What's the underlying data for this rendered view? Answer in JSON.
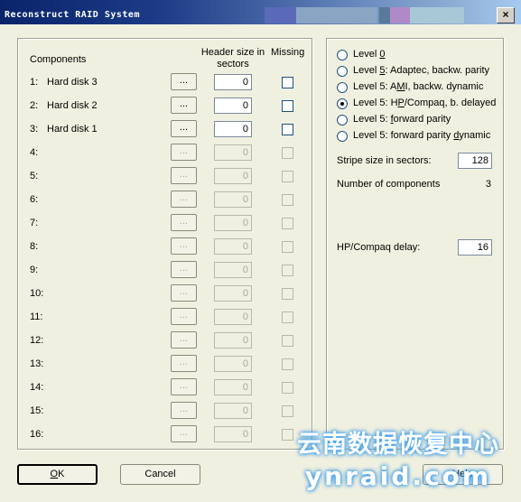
{
  "window": {
    "title": "Reconstruct RAID System",
    "close_label": "×"
  },
  "left": {
    "headers": {
      "components": "Components",
      "header_size": "Header size in sectors",
      "missing": "Missing"
    },
    "browse_label": "...",
    "rows": [
      {
        "num": "1:",
        "name": "Hard disk 3",
        "value": "0",
        "enabled": true
      },
      {
        "num": "2:",
        "name": "Hard disk 2",
        "value": "0",
        "enabled": true
      },
      {
        "num": "3:",
        "name": "Hard disk 1",
        "value": "0",
        "enabled": true
      },
      {
        "num": "4:",
        "name": "",
        "value": "0",
        "enabled": false
      },
      {
        "num": "5:",
        "name": "",
        "value": "0",
        "enabled": false
      },
      {
        "num": "6:",
        "name": "",
        "value": "0",
        "enabled": false
      },
      {
        "num": "7:",
        "name": "",
        "value": "0",
        "enabled": false
      },
      {
        "num": "8:",
        "name": "",
        "value": "0",
        "enabled": false
      },
      {
        "num": "9:",
        "name": "",
        "value": "0",
        "enabled": false
      },
      {
        "num": "10:",
        "name": "",
        "value": "0",
        "enabled": false
      },
      {
        "num": "11:",
        "name": "",
        "value": "0",
        "enabled": false
      },
      {
        "num": "12:",
        "name": "",
        "value": "0",
        "enabled": false
      },
      {
        "num": "13:",
        "name": "",
        "value": "0",
        "enabled": false
      },
      {
        "num": "14:",
        "name": "",
        "value": "0",
        "enabled": false
      },
      {
        "num": "15:",
        "name": "",
        "value": "0",
        "enabled": false
      },
      {
        "num": "16:",
        "name": "",
        "value": "0",
        "enabled": false
      }
    ]
  },
  "right": {
    "levels": [
      {
        "pre": "Level ",
        "ul": "0",
        "post": "",
        "checked": false
      },
      {
        "pre": "Level ",
        "ul": "5",
        "post": ": Adaptec, backw. parity",
        "checked": false
      },
      {
        "pre": "Level 5: A",
        "ul": "M",
        "post": "I, backw. dynamic",
        "checked": false
      },
      {
        "pre": "Level 5: H",
        "ul": "P",
        "post": "/Compaq, b. delayed",
        "checked": true
      },
      {
        "pre": "Level 5: ",
        "ul": "f",
        "post": "orward parity",
        "checked": false
      },
      {
        "pre": "Level 5: forward parity ",
        "ul": "d",
        "post": "ynamic",
        "checked": false
      }
    ],
    "stripe_label": "Stripe size in sectors:",
    "stripe_value": "128",
    "num_components_label": "Number of components",
    "num_components_value": "3",
    "delay_label": "HP/Compaq delay:",
    "delay_value": "16"
  },
  "buttons": {
    "ok_ul": "O",
    "ok_rest": "K",
    "cancel": "Cancel",
    "help": "Help"
  },
  "watermark": {
    "line1": "云南数据恢复中心",
    "line2": "ynraid.com"
  }
}
